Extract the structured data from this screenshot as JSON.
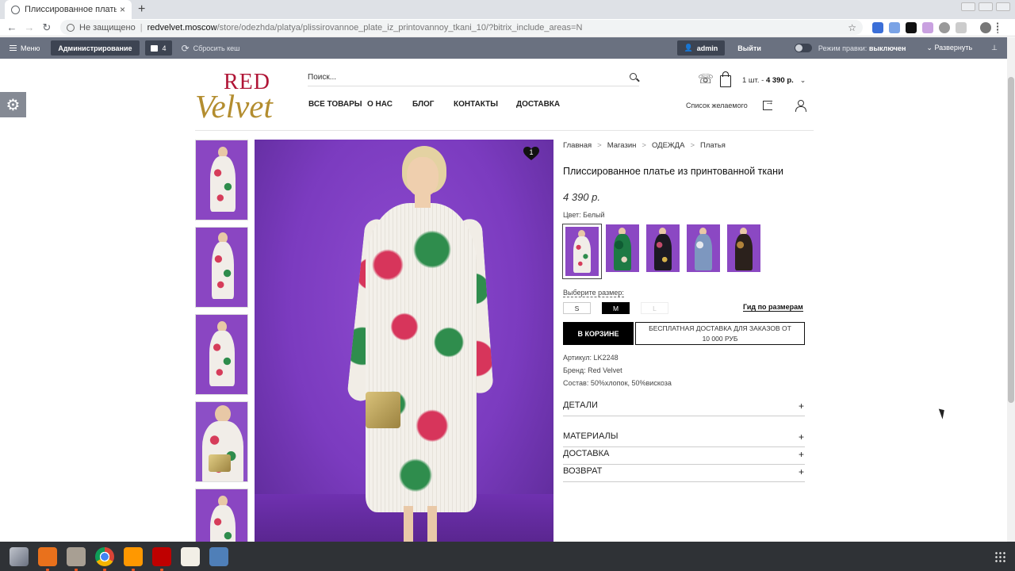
{
  "browser": {
    "tab_title": "Плиссированное платье из",
    "tab_close": "×",
    "new_tab": "+",
    "insecure_label": "Не защищено",
    "url_host": "redvelvet.moscow",
    "url_path": "/store/odezhda/platya/plissirovannoe_plate_iz_printovannoy_tkani_10/?bitrix_include_areas=N"
  },
  "adminbar": {
    "menu": "Меню",
    "admin": "Администрирование",
    "notes_count": "4",
    "clear_cache": "Сбросить кеш",
    "user": "admin",
    "logout": "Выйти",
    "edit_mode_label": "Режим правки:",
    "edit_mode_state": "выключен",
    "expand": "Развернуть"
  },
  "header": {
    "logo_top": "RED",
    "logo_bottom": "Velvet",
    "search_placeholder": "Поиск...",
    "nav": [
      "ВСЕ ТОВАРЫ",
      "О НАС",
      "БЛОГ",
      "КОНТАКТЫ",
      "ДОСТАВКА"
    ],
    "cart_qty": "1 шт. -",
    "cart_sum": "4 390 р.",
    "wishlist": "Список желаемого"
  },
  "gallery": {
    "favorite_count": "1"
  },
  "product": {
    "breadcrumbs": [
      "Главная",
      "Магазин",
      "ОДЕЖДА",
      "Платья"
    ],
    "title": "Плиссированное платье из принтованной ткани",
    "price": "4 390 р.",
    "color_label": "Цвет: Белый",
    "size_label": "Выберите размер:",
    "sizes": [
      "S",
      "M",
      "L"
    ],
    "size_guide": "Гид по размерам",
    "in_cart": "В КОРЗИНЕ",
    "free_shipping": "БЕСПЛАТНАЯ ДОСТАВКА ДЛЯ ЗАКАЗОВ ОТ 10 000 РУБ",
    "article": "Артикул: LK2248",
    "brand": "Бренд: Red Velvet",
    "composition": "Состав: 50%хлопок, 50%вискоза",
    "accordion": [
      "ДЕТАЛИ",
      "МАТЕРИАЛЫ",
      "ДОСТАВКА",
      "ВОЗВРАТ"
    ],
    "accordion_sign": "+"
  },
  "colors": {
    "brand_red": "#b01536",
    "brand_gold": "#b38d2f",
    "admin_bar": "#6a7180",
    "photo_bg": "#7b3bbf"
  }
}
